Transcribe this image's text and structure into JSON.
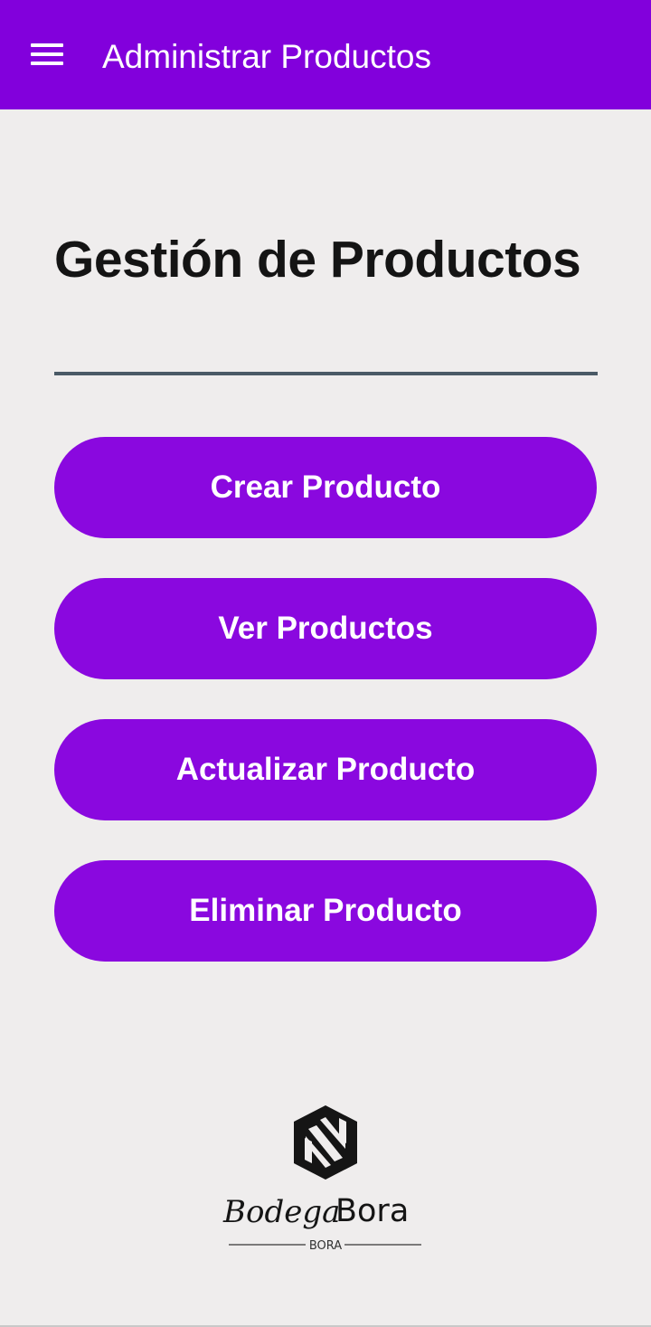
{
  "app_bar": {
    "title": "Administrar Productos",
    "menu_icon": "hamburger-menu-icon",
    "background": "#8200dc"
  },
  "main": {
    "heading": "Gestión de Productos",
    "buttons": [
      {
        "label": "Crear Producto"
      },
      {
        "label": "Ver Productos"
      },
      {
        "label": "Actualizar Producto"
      },
      {
        "label": "Eliminar Producto"
      }
    ],
    "button_color": "#8a08df"
  },
  "logo": {
    "brand_script": "Bodega",
    "brand_bold": "Bora",
    "subtitle": "BORA"
  }
}
